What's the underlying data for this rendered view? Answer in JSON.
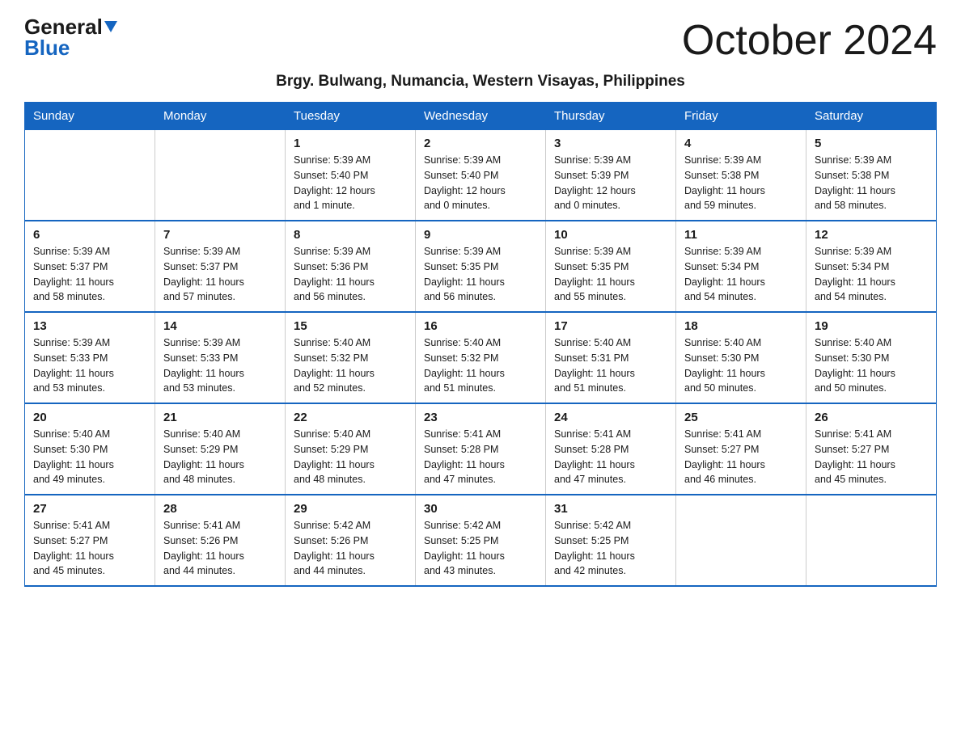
{
  "header": {
    "logo_general": "General",
    "logo_blue": "Blue",
    "month_title": "October 2024",
    "subtitle": "Brgy. Bulwang, Numancia, Western Visayas, Philippines"
  },
  "days_of_week": [
    "Sunday",
    "Monday",
    "Tuesday",
    "Wednesday",
    "Thursday",
    "Friday",
    "Saturday"
  ],
  "weeks": [
    [
      {
        "day": "",
        "info": ""
      },
      {
        "day": "",
        "info": ""
      },
      {
        "day": "1",
        "info": "Sunrise: 5:39 AM\nSunset: 5:40 PM\nDaylight: 12 hours\nand 1 minute."
      },
      {
        "day": "2",
        "info": "Sunrise: 5:39 AM\nSunset: 5:40 PM\nDaylight: 12 hours\nand 0 minutes."
      },
      {
        "day": "3",
        "info": "Sunrise: 5:39 AM\nSunset: 5:39 PM\nDaylight: 12 hours\nand 0 minutes."
      },
      {
        "day": "4",
        "info": "Sunrise: 5:39 AM\nSunset: 5:38 PM\nDaylight: 11 hours\nand 59 minutes."
      },
      {
        "day": "5",
        "info": "Sunrise: 5:39 AM\nSunset: 5:38 PM\nDaylight: 11 hours\nand 58 minutes."
      }
    ],
    [
      {
        "day": "6",
        "info": "Sunrise: 5:39 AM\nSunset: 5:37 PM\nDaylight: 11 hours\nand 58 minutes."
      },
      {
        "day": "7",
        "info": "Sunrise: 5:39 AM\nSunset: 5:37 PM\nDaylight: 11 hours\nand 57 minutes."
      },
      {
        "day": "8",
        "info": "Sunrise: 5:39 AM\nSunset: 5:36 PM\nDaylight: 11 hours\nand 56 minutes."
      },
      {
        "day": "9",
        "info": "Sunrise: 5:39 AM\nSunset: 5:35 PM\nDaylight: 11 hours\nand 56 minutes."
      },
      {
        "day": "10",
        "info": "Sunrise: 5:39 AM\nSunset: 5:35 PM\nDaylight: 11 hours\nand 55 minutes."
      },
      {
        "day": "11",
        "info": "Sunrise: 5:39 AM\nSunset: 5:34 PM\nDaylight: 11 hours\nand 54 minutes."
      },
      {
        "day": "12",
        "info": "Sunrise: 5:39 AM\nSunset: 5:34 PM\nDaylight: 11 hours\nand 54 minutes."
      }
    ],
    [
      {
        "day": "13",
        "info": "Sunrise: 5:39 AM\nSunset: 5:33 PM\nDaylight: 11 hours\nand 53 minutes."
      },
      {
        "day": "14",
        "info": "Sunrise: 5:39 AM\nSunset: 5:33 PM\nDaylight: 11 hours\nand 53 minutes."
      },
      {
        "day": "15",
        "info": "Sunrise: 5:40 AM\nSunset: 5:32 PM\nDaylight: 11 hours\nand 52 minutes."
      },
      {
        "day": "16",
        "info": "Sunrise: 5:40 AM\nSunset: 5:32 PM\nDaylight: 11 hours\nand 51 minutes."
      },
      {
        "day": "17",
        "info": "Sunrise: 5:40 AM\nSunset: 5:31 PM\nDaylight: 11 hours\nand 51 minutes."
      },
      {
        "day": "18",
        "info": "Sunrise: 5:40 AM\nSunset: 5:30 PM\nDaylight: 11 hours\nand 50 minutes."
      },
      {
        "day": "19",
        "info": "Sunrise: 5:40 AM\nSunset: 5:30 PM\nDaylight: 11 hours\nand 50 minutes."
      }
    ],
    [
      {
        "day": "20",
        "info": "Sunrise: 5:40 AM\nSunset: 5:30 PM\nDaylight: 11 hours\nand 49 minutes."
      },
      {
        "day": "21",
        "info": "Sunrise: 5:40 AM\nSunset: 5:29 PM\nDaylight: 11 hours\nand 48 minutes."
      },
      {
        "day": "22",
        "info": "Sunrise: 5:40 AM\nSunset: 5:29 PM\nDaylight: 11 hours\nand 48 minutes."
      },
      {
        "day": "23",
        "info": "Sunrise: 5:41 AM\nSunset: 5:28 PM\nDaylight: 11 hours\nand 47 minutes."
      },
      {
        "day": "24",
        "info": "Sunrise: 5:41 AM\nSunset: 5:28 PM\nDaylight: 11 hours\nand 47 minutes."
      },
      {
        "day": "25",
        "info": "Sunrise: 5:41 AM\nSunset: 5:27 PM\nDaylight: 11 hours\nand 46 minutes."
      },
      {
        "day": "26",
        "info": "Sunrise: 5:41 AM\nSunset: 5:27 PM\nDaylight: 11 hours\nand 45 minutes."
      }
    ],
    [
      {
        "day": "27",
        "info": "Sunrise: 5:41 AM\nSunset: 5:27 PM\nDaylight: 11 hours\nand 45 minutes."
      },
      {
        "day": "28",
        "info": "Sunrise: 5:41 AM\nSunset: 5:26 PM\nDaylight: 11 hours\nand 44 minutes."
      },
      {
        "day": "29",
        "info": "Sunrise: 5:42 AM\nSunset: 5:26 PM\nDaylight: 11 hours\nand 44 minutes."
      },
      {
        "day": "30",
        "info": "Sunrise: 5:42 AM\nSunset: 5:25 PM\nDaylight: 11 hours\nand 43 minutes."
      },
      {
        "day": "31",
        "info": "Sunrise: 5:42 AM\nSunset: 5:25 PM\nDaylight: 11 hours\nand 42 minutes."
      },
      {
        "day": "",
        "info": ""
      },
      {
        "day": "",
        "info": ""
      }
    ]
  ]
}
